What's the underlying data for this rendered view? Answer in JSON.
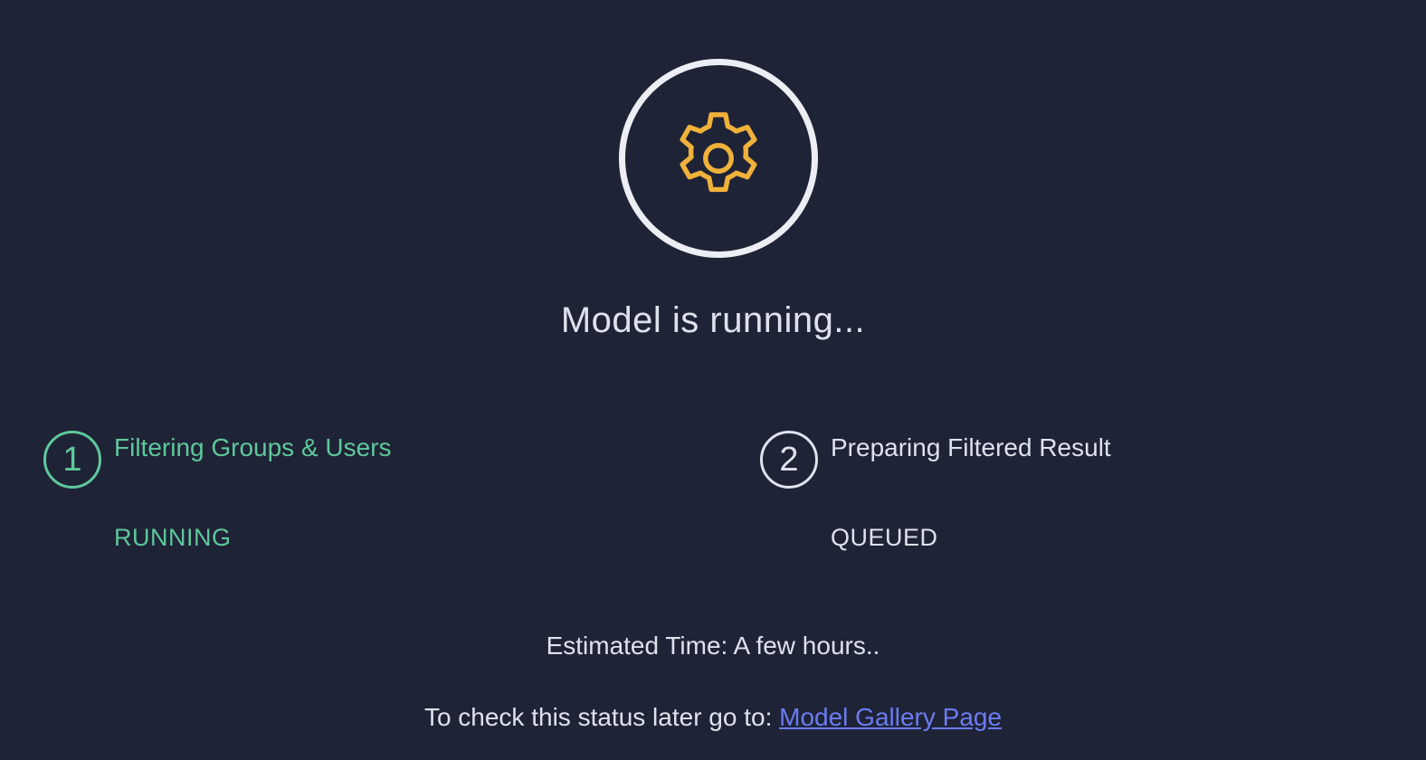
{
  "status_icon": {
    "name": "gear-icon",
    "color": "#f0b23a",
    "ring_color": "#eceef3"
  },
  "headline": "Model is running...",
  "steps": [
    {
      "number": "1",
      "title": "Filtering Groups & Users",
      "status": "RUNNING",
      "color": "#5ec89b"
    },
    {
      "number": "2",
      "title": "Preparing Filtered Result",
      "status": "QUEUED",
      "color": "#dfe1ec"
    }
  ],
  "estimated_time": "Estimated Time: A few hours..",
  "later_check": {
    "prefix": "To check this status later go to: ",
    "link_text": "Model Gallery Page",
    "link_color": "#6b7cf2"
  },
  "colors": {
    "background": "#1f2336",
    "text": "#dfe1ec"
  }
}
